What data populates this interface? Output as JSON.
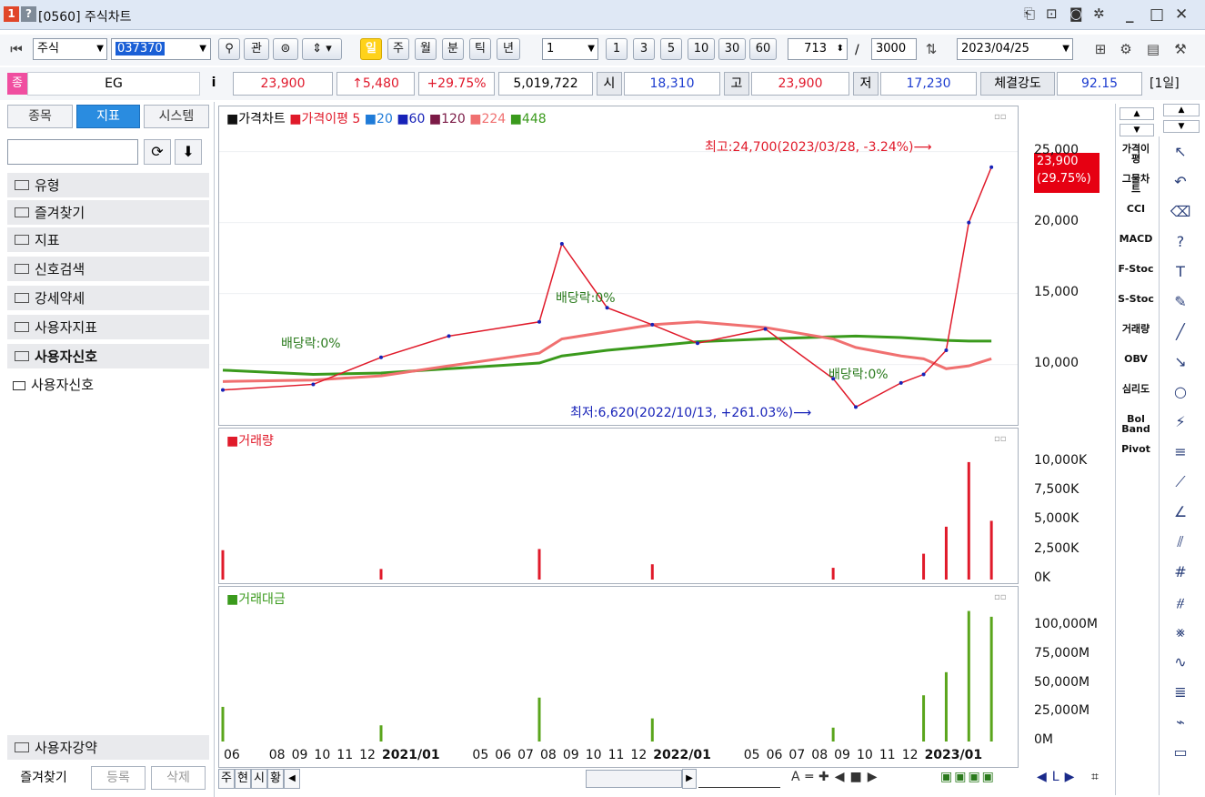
{
  "window": {
    "badge1": "1",
    "badge2": "?",
    "title": "[0560] 주식차트",
    "controls": [
      "_",
      "□",
      "✕"
    ]
  },
  "toolbar": {
    "market": "주식",
    "code": "037370",
    "search_icon": "magnifier-icon",
    "btn_gwan": "관",
    "periods": [
      "일",
      "주",
      "월",
      "분",
      "틱",
      "년"
    ],
    "active_period": "일",
    "unit_value": "1",
    "quick_units": [
      "1",
      "3",
      "5",
      "10",
      "30",
      "60"
    ],
    "display_count": "713",
    "slash": "/",
    "total_count": "3000",
    "date": "2023/04/25"
  },
  "info": {
    "badge": "종",
    "name": "EG",
    "info_btn": "i",
    "price": "23,900",
    "change": "↑5,480",
    "change_pct": "+29.75%",
    "volume": "5,019,722",
    "open_label": "시",
    "open": "18,310",
    "high_label": "고",
    "high": "23,900",
    "low_label": "저",
    "low": "17,230",
    "strength_label": "체결강도",
    "strength": "92.15",
    "period_tag": "[1일]"
  },
  "left": {
    "tabs": [
      "종목",
      "지표",
      "시스템"
    ],
    "active_tab": "지표",
    "folders": [
      "유형",
      "즐겨찾기",
      "지표",
      "신호검색",
      "강세약세",
      "사용자지표",
      "사용자신호"
    ],
    "leaf": "사용자신호",
    "bottom_folder": "사용자강약",
    "bottom_tabs": [
      "즐겨찾기",
      "등록",
      "삭제"
    ]
  },
  "chart_data": [
    {
      "type": "line",
      "title": "가격차트",
      "legend": [
        "가격차트",
        "가격이평 5",
        "20",
        "60",
        "120",
        "224",
        "448"
      ],
      "legend_colors": [
        "#111111",
        "#e01a2a",
        "#1f7bd8",
        "#1722b8",
        "#7b1a46",
        "#f07070",
        "#3a9a1c"
      ],
      "ylim": [
        6000,
        26000
      ],
      "yticks": [
        "25,000",
        "20,000",
        "15,000",
        "10,000"
      ],
      "ytick_values": [
        25000,
        20000,
        15000,
        10000
      ],
      "current_price": "23,900",
      "current_pct": "(29.75%)",
      "annotations": {
        "high": "최고:24,700(2023/03/28, -3.24%)⟶",
        "low": "최저:6,620(2022/10/13, +261.03%)⟶",
        "dividend1": "배당락:0%",
        "dividend2": "배당락:0%",
        "dividend3": "배당락:0%"
      },
      "x": [
        "2020-06",
        "2020-10",
        "2021-01",
        "2021-04",
        "2021-08",
        "2021-09",
        "2021-11",
        "2022-01",
        "2022-03",
        "2022-06",
        "2022-09",
        "2022-10",
        "2022-12",
        "2023-01",
        "2023-02",
        "2023-03",
        "2023-04"
      ],
      "close": [
        8200,
        8600,
        10500,
        12000,
        13000,
        18500,
        14000,
        12800,
        11500,
        12500,
        9000,
        7000,
        8700,
        9300,
        11000,
        20000,
        23900
      ],
      "ma224": [
        8800,
        8900,
        9200,
        9900,
        10800,
        11800,
        12300,
        12800,
        13000,
        12600,
        11800,
        11200,
        10600,
        10400,
        9700,
        9900,
        10400
      ],
      "ma448": [
        9600,
        9300,
        9400,
        9700,
        10100,
        10600,
        11000,
        11300,
        11600,
        11800,
        11950,
        12000,
        11900,
        11800,
        11700,
        11650,
        11650
      ]
    },
    {
      "type": "bar",
      "title": "거래량",
      "yticks": [
        "10,000K",
        "7,500K",
        "5,000K",
        "2,500K",
        "0K"
      ],
      "ytick_values": [
        10000,
        7500,
        5000,
        2500,
        0
      ],
      "ylim": [
        0,
        11000
      ],
      "x": [
        "2020-06",
        "2021-01",
        "2021-08",
        "2022-01",
        "2022-09",
        "2023-01",
        "2023-02",
        "2023-03",
        "2023-04"
      ],
      "values": [
        2500,
        900,
        2600,
        1300,
        1000,
        2200,
        4500,
        10000,
        5000
      ]
    },
    {
      "type": "bar",
      "title": "거래대금",
      "yticks": [
        "100,000M",
        "75,000M",
        "50,000M",
        "25,000M",
        "0M"
      ],
      "ytick_values": [
        100000,
        75000,
        50000,
        25000,
        0
      ],
      "ylim": [
        0,
        115000
      ],
      "x": [
        "2020-06",
        "2021-01",
        "2021-08",
        "2022-01",
        "2022-09",
        "2023-01",
        "2023-02",
        "2023-03",
        "2023-04"
      ],
      "values": [
        30000,
        14000,
        38000,
        20000,
        12000,
        40000,
        60000,
        113000,
        108000
      ]
    }
  ],
  "xaxis": {
    "ticks": [
      "06",
      "08",
      "09",
      "10",
      "11",
      "12",
      "2021/01",
      "05",
      "06",
      "07",
      "08",
      "09",
      "10",
      "11",
      "12",
      "2022/01",
      "05",
      "06",
      "07",
      "08",
      "09",
      "10",
      "11",
      "12",
      "2023/01"
    ]
  },
  "indicators": [
    "가격이평",
    "그물차트",
    "CCI",
    "MACD",
    "F-Stoc",
    "S-Stoc",
    "거래량",
    "OBV",
    "심리도",
    "Bol Band",
    "Pivot"
  ],
  "tools": [
    "cursor-icon",
    "undo-icon",
    "erase-all-icon",
    "help-icon",
    "text-icon",
    "marker-icon",
    "line-icon",
    "ray-icon",
    "circle-icon",
    "andrews-icon",
    "parallel-icon",
    "gann-icon",
    "fan-icon",
    "cross-lines-icon",
    "grid-icon",
    "channel-icon",
    "crossing-icon",
    "wave-icon",
    "fibonacci-icon",
    "auto-icon",
    "window-icon"
  ],
  "bottom": {
    "buttons": [
      "주",
      "현",
      "시",
      "황"
    ],
    "nav": [
      "A",
      "═",
      "✚",
      "◀",
      "■",
      "▶",
      "◀",
      "L",
      "▶"
    ]
  },
  "colors": {
    "up": "#e01a2a",
    "down": "#1722b8",
    "volume_pane2": "#5aa51c",
    "active_tab": "#2a8ce0",
    "active_period": "#ffd21a"
  }
}
